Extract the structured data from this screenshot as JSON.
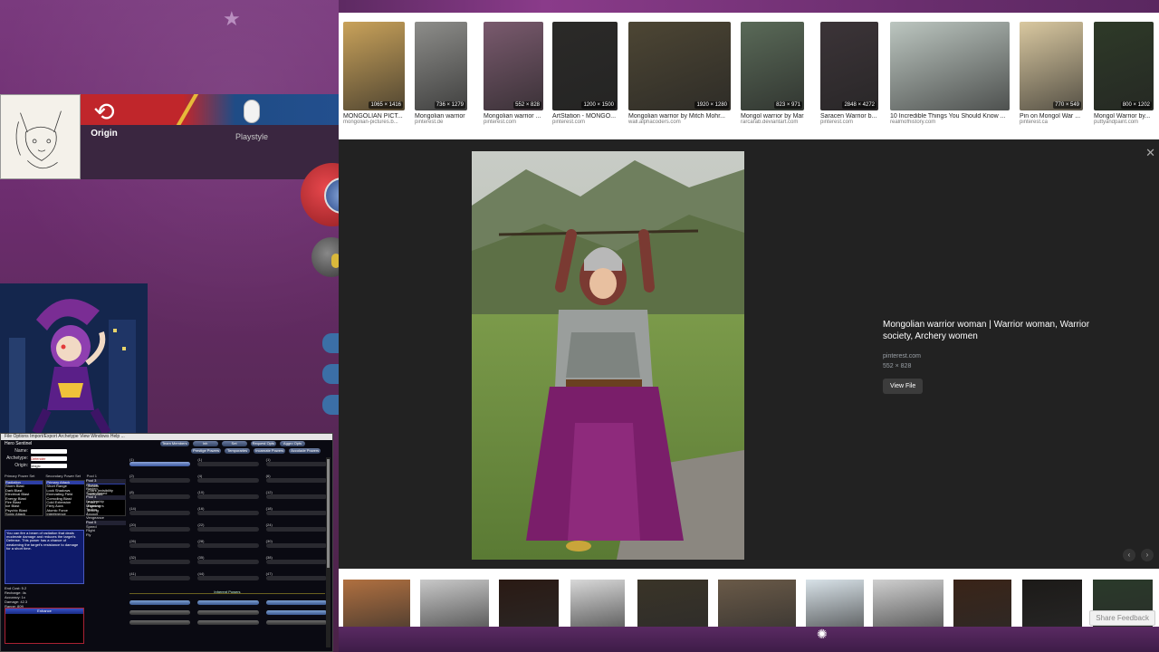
{
  "overlay": {
    "origin_label": "Origin",
    "playstyle_label": "Playstyle"
  },
  "editor": {
    "menubar": "File  Options  Import/Export  Archetype  View  Windows  Help  ...",
    "title": "Hero Sentinel",
    "name_label": "Name:",
    "archetype_label": "Archetype:",
    "origin_label": "Origin:",
    "archetype_value": "Defender",
    "origin_value": "Magic",
    "top_buttons": [
      "Team Members",
      "Inh",
      "Set",
      "Request Opts",
      "Aggro Opts"
    ],
    "top_buttons2": [
      "Prestige Powers",
      "Temporaries",
      "Incarnate Powers",
      "Accolade Powers"
    ],
    "col_heads": [
      "Primary Power Set",
      "Secondary Power Set",
      "Pool 1"
    ],
    "primary_list": [
      "Radiation",
      "Storm Blast",
      "Dark Blast",
      "Electrical Blast",
      "Energy Blast",
      "Fire Blast",
      "Ice Blast",
      "Psychic Blast",
      "Sonic Attack"
    ],
    "secondary_list": [
      "Primary Attack",
      "Short Range",
      "Lock Shadows",
      "Enervating Field",
      "Corroding Blast",
      "Cold Extension",
      "Fiery Aura",
      "Atomic Force",
      "Interference"
    ],
    "pool_list": [
      "Concealment",
      "Stealth",
      "Grant Invisibility",
      "Invisibility",
      "Phase Shift",
      "Pool 2",
      "Fighting",
      "Boxing"
    ],
    "powers_list": [
      "Pool 3",
      "Fitness",
      "Hasten",
      "Super Speed",
      "Pool 4",
      "Leadership",
      "Maneuvers",
      "Tactics",
      "Assault",
      "Vengeance",
      "Pool 5",
      "Speed",
      "Flight",
      "Fly"
    ],
    "description": "You can fire a beam of radiation that deals moderate damage and reduces the target's Defense. This power has a chance of weakening the target's resistance to damage for a short time.",
    "stats": [
      "End Cost: 5.2",
      "Recharge: 4s",
      "Accuracy: 1x",
      "Damage: 42.3",
      "Range: 80ft",
      "Cast: 1.67s"
    ],
    "bottom_bar": "Enhance",
    "slot_labels": [
      "(1)",
      "(1)",
      "(1)",
      "(2)",
      "(4)",
      "(6)",
      "(8)",
      "(10)",
      "(12)",
      "(14)",
      "(16)",
      "(18)",
      "(20)",
      "(22)",
      "(24)",
      "(26)",
      "(28)",
      "(30)",
      "(32)",
      "(35)",
      "(38)",
      "(41)",
      "(44)",
      "(47)",
      "(49)"
    ],
    "inherent_label": "Inherent Powers"
  },
  "gallery": {
    "thumbnails": [
      {
        "title": "MONGOLIAN PICT...",
        "source": "mongolian-pictures.b...",
        "size": "1065 × 1416",
        "color": "#c9a25a"
      },
      {
        "title": "Mongolian warrior ...",
        "source": "pinterest.de",
        "size": "736 × 1279",
        "color": "#8d8d8a"
      },
      {
        "title": "Mongolian warrior ...",
        "source": "pinterest.com",
        "size": "552 × 828",
        "color": "#7a5a6e"
      },
      {
        "title": "ArtStation - MONGO...",
        "source": "pinterest.com",
        "size": "1200 × 1500",
        "color": "#2b2a28"
      },
      {
        "title": "Mongolian warrior by Mitch Mohr...",
        "source": "wall.alphacoders.com",
        "size": "1920 × 1280",
        "color": "#4d4634"
      },
      {
        "title": "Mongol warrior by Mar...",
        "source": "rarcarab.deviantart.com",
        "size": "823 × 971",
        "color": "#5a6a58"
      },
      {
        "title": "Saracen Warrior b...",
        "source": "pinterest.com",
        "size": "2848 × 4272",
        "color": "#3c3438"
      },
      {
        "title": "10 Incredible Things You Should Know ...",
        "source": "realmofhistory.com",
        "size": "",
        "color": "#bcc6c0"
      },
      {
        "title": "Pin on Mongol War ...",
        "source": "pinterest.ca",
        "size": "770 × 549",
        "color": "#d9c8a0"
      },
      {
        "title": "Mongol Warrior by...",
        "source": "puttyandpaint.com",
        "size": "800 × 1202",
        "color": "#2e3a28"
      }
    ],
    "selected": {
      "title": "Mongolian warrior woman | Warrior woman, Warrior society, Archery women",
      "source": "pinterest.com",
      "dimensions": "552 × 828",
      "view_file_label": "View File"
    },
    "bottom_thumbs": [
      "#b07040",
      "#c8c8c8",
      "#2a1a14",
      "#d8d8d8",
      "#3a3428",
      "#6a5a48",
      "#d8e2e8",
      "#cfcfcf",
      "#3a2418",
      "#1c1a18",
      "#2a3a2a"
    ],
    "share_feedback_label": "Share Feedback"
  }
}
